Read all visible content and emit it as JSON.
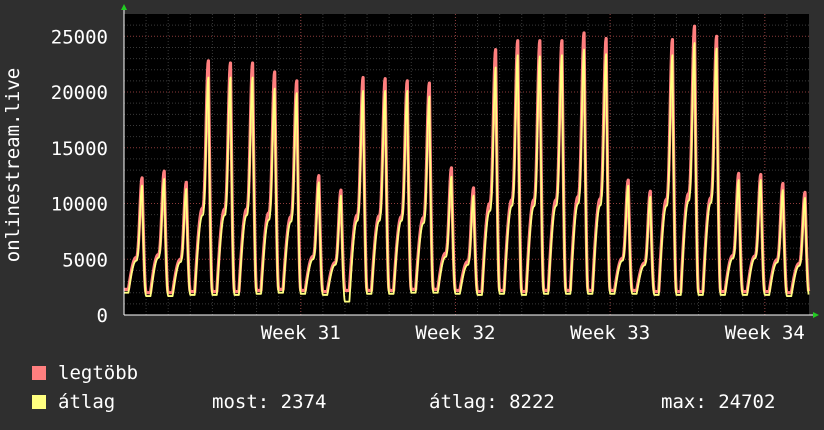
{
  "chart_data": {
    "type": "area",
    "ylabel": "onlinestream.live",
    "ylim": [
      0,
      27000
    ],
    "yticks": [
      0,
      5000,
      10000,
      15000,
      20000,
      25000
    ],
    "xticks": [
      {
        "label": "Week 31",
        "day": 8
      },
      {
        "label": "Week 32",
        "day": 15
      },
      {
        "label": "Week 33",
        "day": 22
      },
      {
        "label": "Week 34",
        "day": 29
      }
    ],
    "days": 31,
    "grid": true,
    "legend_placement": "bottom",
    "series": [
      {
        "name": "legtöbb",
        "color": "#ff7f7f",
        "daily_peak": [
          12300,
          12900,
          11900,
          22800,
          22600,
          22600,
          21800,
          21000,
          12500,
          11200,
          21300,
          21200,
          21000,
          20800,
          13200,
          11400,
          23800,
          24600,
          24600,
          24600,
          25300,
          24800,
          12100,
          11100,
          24700,
          25900,
          25000,
          12700,
          12600,
          11800,
          11000
        ],
        "daily_min": [
          2300,
          2000,
          2000,
          2100,
          2100,
          2100,
          2200,
          2300,
          2200,
          2100,
          2200,
          2200,
          2200,
          2300,
          2300,
          2200,
          2100,
          2200,
          2100,
          2200,
          2200,
          2200,
          2200,
          2200,
          2100,
          2100,
          2100,
          2100,
          2100,
          2100,
          2000
        ]
      },
      {
        "name": "átlag",
        "color": "#ffff80",
        "daily_peak": [
          11600,
          12200,
          11300,
          21300,
          21300,
          21300,
          20300,
          19900,
          11900,
          10700,
          20100,
          20100,
          20100,
          19600,
          12400,
          10700,
          22200,
          23300,
          23200,
          23300,
          23800,
          23400,
          11600,
          10600,
          23300,
          24400,
          23900,
          12100,
          12100,
          11200,
          10500
        ],
        "daily_min": [
          2000,
          1700,
          1700,
          1800,
          1800,
          1800,
          1900,
          2000,
          1900,
          1800,
          1200,
          1900,
          1900,
          2000,
          2000,
          1900,
          1800,
          1900,
          1800,
          1900,
          1900,
          1900,
          1900,
          1900,
          1800,
          1800,
          1800,
          1800,
          1800,
          1800,
          1700
        ]
      }
    ]
  },
  "legend": {
    "max_label": "legtöbb",
    "avg_label": "átlag",
    "now_stat": "most: 2374",
    "avg_stat": "átlag: 8222",
    "max_stat": "max: 24702"
  }
}
